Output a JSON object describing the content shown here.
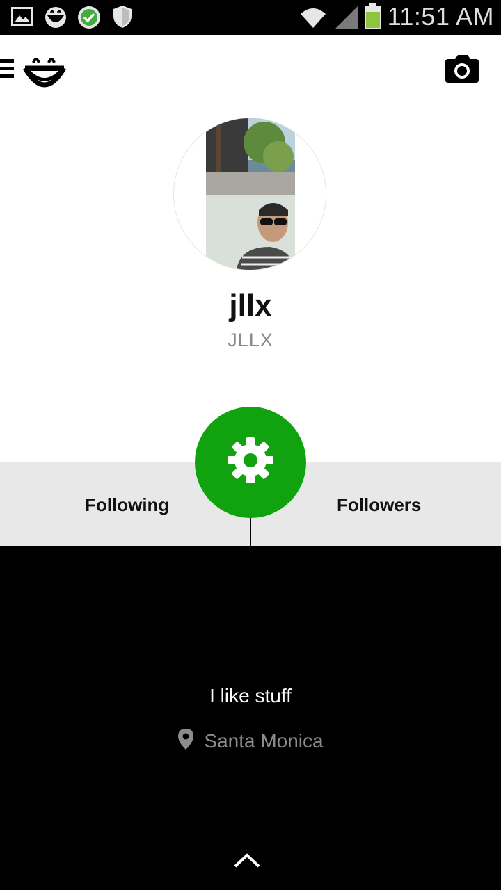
{
  "status_bar": {
    "time": "11:51 AM",
    "icons": [
      "gallery-icon",
      "smiley-notification-icon",
      "check-circle-icon",
      "shield-icon",
      "wifi-icon",
      "signal-icon",
      "battery-icon"
    ]
  },
  "app_bar": {
    "menu_icon": "hamburger-icon",
    "logo_icon": "smiley-logo-icon",
    "camera_icon": "camera-icon"
  },
  "profile": {
    "username": "jllx",
    "display_name": "JLLX"
  },
  "tabs": {
    "following_label": "Following",
    "followers_label": "Followers",
    "settings_icon": "gear-icon"
  },
  "bio": {
    "text": "I like stuff",
    "location": "Santa Monica",
    "location_icon": "location-pin-icon",
    "expand_icon": "chevron-up-icon"
  },
  "colors": {
    "accent_green": "#10a30f",
    "status_bar_bg": "#000000",
    "tabs_bg": "#e8e8e8",
    "bio_bg": "#000000",
    "battery_green": "#8cc63f"
  }
}
